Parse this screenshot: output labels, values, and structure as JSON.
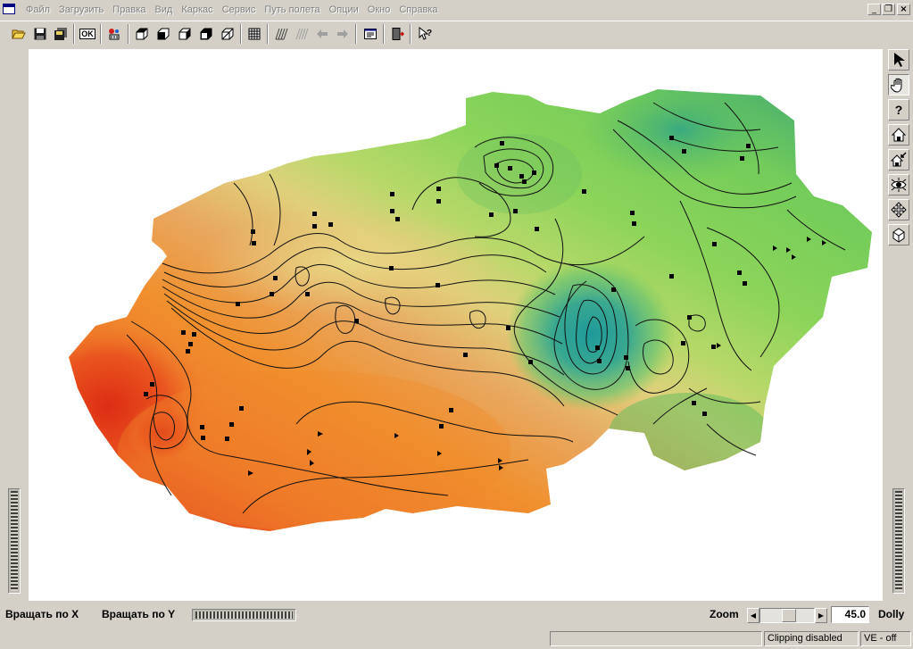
{
  "menubar": {
    "items": [
      "Файл",
      "Загрузить",
      "Правка",
      "Вид",
      "Каркас",
      "Сервис",
      "Путь полета",
      "Опции",
      "Окно",
      "Справка"
    ]
  },
  "window_controls": {
    "minimize": "_",
    "restore": "❐",
    "close": "×"
  },
  "toolbar": {
    "ok_label": "OK",
    "buttons": [
      "open",
      "save",
      "save-all",
      "ok",
      "objects",
      "view-top",
      "view-front",
      "view-side",
      "view-iso-left",
      "view-iso-right",
      "grid",
      "wireframe-1",
      "wireframe-2",
      "back-arrow",
      "forward-arrow",
      "properties",
      "exit",
      "context-help"
    ]
  },
  "right_tools": [
    "pointer-icon",
    "hand-icon",
    "help-icon",
    "home-icon",
    "home-arrow-icon",
    "eye-icon",
    "move-icon",
    "cube-icon"
  ],
  "right_tools_help": "?",
  "bottom": {
    "rotate_x_label": "Вращать по X",
    "rotate_y_label": "Вращать по Y",
    "zoom_label": "Zoom",
    "zoom_value": "45.0",
    "zoom_fraction": 0.55,
    "dolly_label": "Dolly"
  },
  "status": {
    "main": "",
    "clipping": "Clipping disabled",
    "ve": "VE - off"
  },
  "colors": {
    "surface_red": "#e0301a",
    "surface_orange": "#f0882a",
    "surface_yellow": "#e8d27a",
    "surface_green": "#8cd45a",
    "surface_teal": "#3aa890"
  }
}
